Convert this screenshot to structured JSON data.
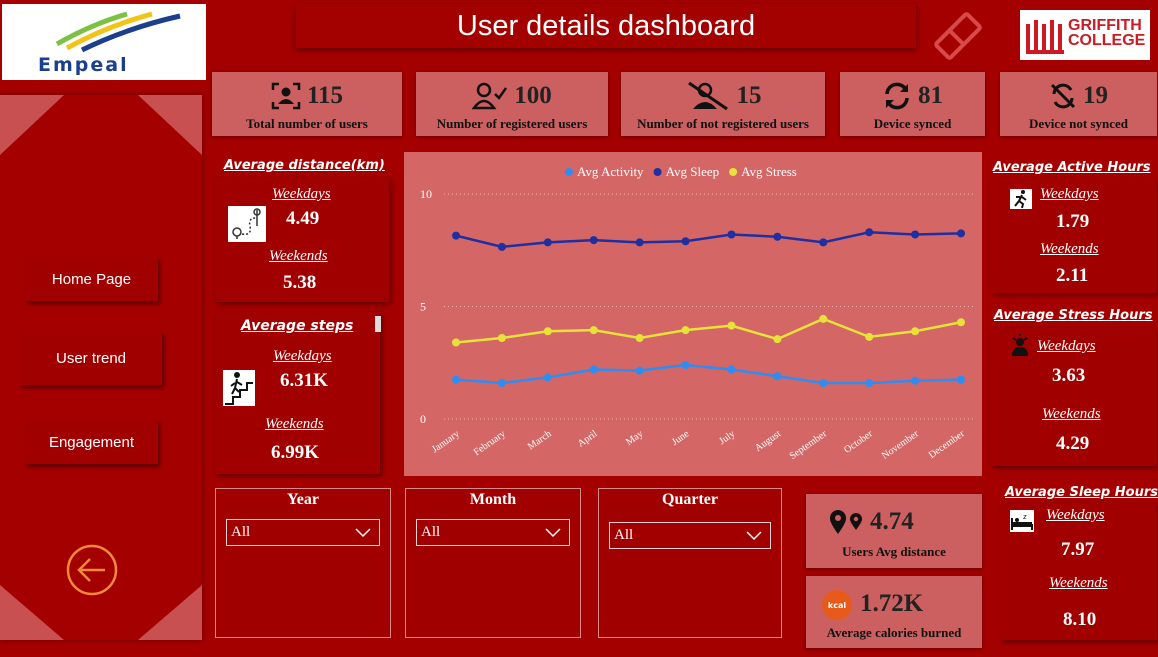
{
  "logos": {
    "left_text": "Empeal",
    "right_text_line1": "GRIFFITH",
    "right_text_line2": "COLLEGE"
  },
  "header": {
    "title": "User details dashboard"
  },
  "sidebar": {
    "items": [
      {
        "label": "Home Page"
      },
      {
        "label": "User trend"
      },
      {
        "label": "Engagement"
      }
    ]
  },
  "kpis": [
    {
      "value": "115",
      "label": "Total number of users",
      "icon": "user-scan-icon"
    },
    {
      "value": "100",
      "label": "Number of registered users",
      "icon": "user-check-icon"
    },
    {
      "value": "15",
      "label": "Number of not registered users",
      "icon": "user-off-icon"
    },
    {
      "value": "81",
      "label": "Device synced",
      "icon": "sync-icon"
    },
    {
      "value": "19",
      "label": "Device not synced",
      "icon": "sync-off-icon"
    }
  ],
  "avg_distance": {
    "title": "Average distance(km)",
    "weekdays_label": "Weekdays",
    "weekdays": "4.49",
    "weekends_label": "Weekends",
    "weekends": "5.38"
  },
  "avg_steps": {
    "title": "Average steps",
    "weekdays_label": "Weekdays",
    "weekdays": "6.31K",
    "weekends_label": "Weekends",
    "weekends": "6.99K"
  },
  "active_hours": {
    "title": "Average Active Hours",
    "weekdays_label": "Weekdays",
    "weekdays": "1.79",
    "weekends_label": "Weekends",
    "weekends": "2.11"
  },
  "stress_hours": {
    "title": "Average Stress Hours",
    "weekdays_label": "Weekdays",
    "weekdays": "3.63",
    "weekends_label": "Weekends",
    "weekends": "4.29"
  },
  "sleep_hours": {
    "title": "Average Sleep Hours",
    "weekdays_label": "Weekdays",
    "weekdays": "7.97",
    "weekends_label": "Weekends",
    "weekends": "8.10"
  },
  "chart_data": {
    "type": "line",
    "title": "",
    "xlabel": "",
    "ylabel": "",
    "ylim": [
      0,
      10
    ],
    "yticks": [
      "10",
      "5",
      "0"
    ],
    "legend_position": "top",
    "grid": true,
    "categories": [
      "January",
      "February",
      "March",
      "April",
      "May",
      "June",
      "July",
      "August",
      "September",
      "October",
      "November",
      "December"
    ],
    "series": [
      {
        "name": "Avg Activity",
        "color": "#2f8cf0",
        "values": [
          1.75,
          1.6,
          1.85,
          2.2,
          2.15,
          2.4,
          2.2,
          1.9,
          1.6,
          1.6,
          1.7,
          1.75
        ]
      },
      {
        "name": "Avg Sleep",
        "color": "#1f2f9f",
        "values": [
          8.15,
          7.65,
          7.85,
          7.95,
          7.85,
          7.9,
          8.2,
          8.1,
          7.85,
          8.3,
          8.2,
          8.25
        ]
      },
      {
        "name": "Avg Stress",
        "color": "#e6e23a",
        "values": [
          3.4,
          3.6,
          3.9,
          3.95,
          3.6,
          3.95,
          4.15,
          3.55,
          4.45,
          3.65,
          3.9,
          4.3
        ]
      }
    ]
  },
  "slicers": [
    {
      "title": "Year",
      "value": "All"
    },
    {
      "title": "Month",
      "value": "All"
    },
    {
      "title": "Quarter",
      "value": "All"
    }
  ],
  "users_avg_distance": {
    "value": "4.74",
    "label": "Users Avg distance"
  },
  "avg_calories": {
    "value": "1.72K",
    "label": "Average calories burned",
    "icon_text": "kcal"
  }
}
